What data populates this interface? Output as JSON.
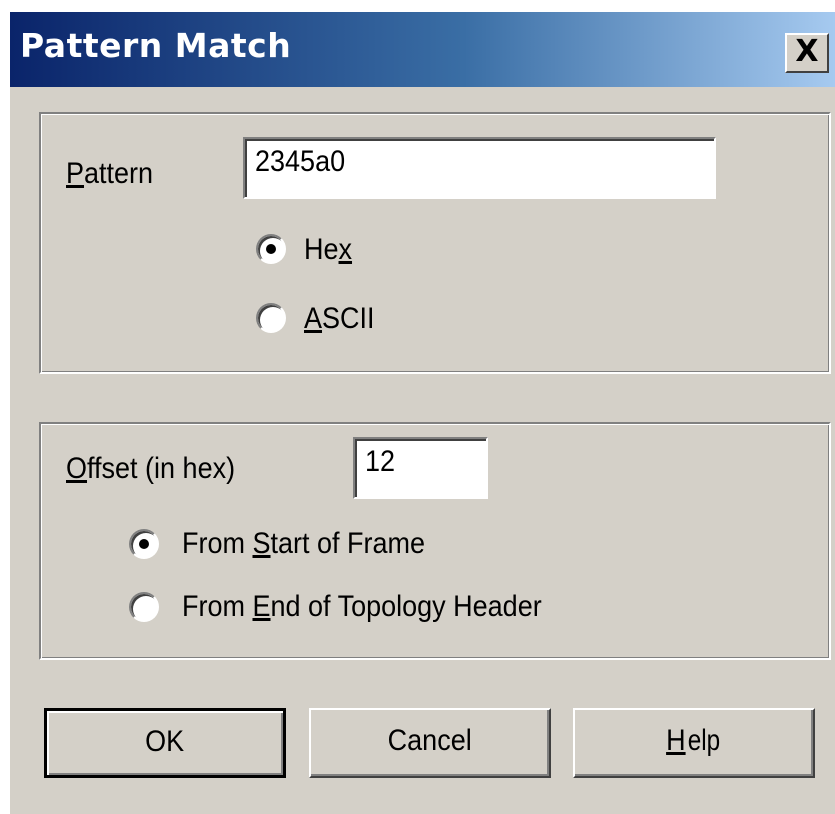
{
  "dialog": {
    "title": "Pattern Match",
    "close_label": "X"
  },
  "pattern_group": {
    "pattern_label_mnemonic": "P",
    "pattern_label_rest": "attern",
    "pattern_value": "2345a0",
    "hex_label_pre": "He",
    "hex_label_mnemonic": "x",
    "hex_selected": true,
    "ascii_label_mnemonic": "A",
    "ascii_label_rest": "SCII",
    "ascii_selected": false
  },
  "offset_group": {
    "offset_label_mnemonic": "O",
    "offset_label_rest": "ffset (in hex)",
    "offset_value": "12",
    "from_start_pre": "From ",
    "from_start_mnemonic": "S",
    "from_start_rest": "tart of Frame",
    "from_start_selected": true,
    "from_end_pre": "From ",
    "from_end_mnemonic": "E",
    "from_end_rest": "nd of Topology Header",
    "from_end_selected": false
  },
  "buttons": {
    "ok_label": "OK",
    "cancel_label": "Cancel",
    "help_mnemonic": "H",
    "help_rest": "elp"
  },
  "colors": {
    "dialog_face": "#d4d0c8",
    "titlebar_start": "#0a246a",
    "titlebar_end": "#a6caf0"
  }
}
